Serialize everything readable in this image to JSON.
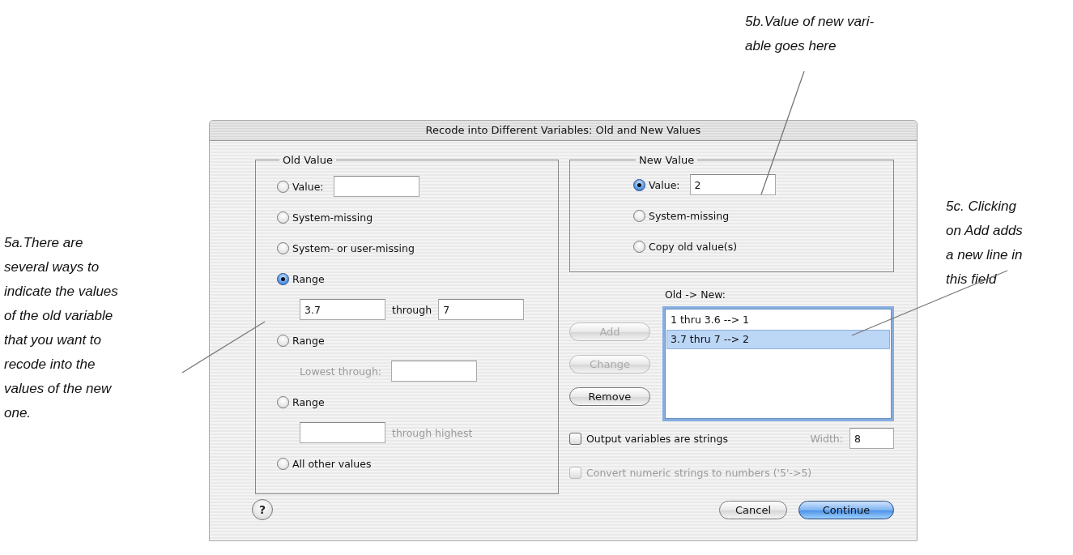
{
  "annotations": [
    {
      "kind": "left",
      "text": "5a.There are\nseveral ways to\nindicate the values\nof the old variable\nthat you want to\nrecode into the\nvalues of the new\none."
    },
    {
      "kind": "top",
      "text": "5b.Value of new vari-\nable goes here"
    },
    {
      "kind": "right",
      "text": "5c. Clicking\non Add adds\na new line in\nthis field"
    }
  ],
  "dialog": {
    "title": "Recode into Different Variables: Old and New Values",
    "old_value": {
      "legend": "Old Value",
      "options": [
        {
          "kind": "field",
          "label": "Value:",
          "selected": false
        },
        {
          "kind": "plain",
          "label": "System-missing",
          "selected": false
        },
        {
          "kind": "plain",
          "label": "System- or user-missing",
          "selected": false
        },
        {
          "kind": "range",
          "label": "Range",
          "selected": true,
          "from": "3.7",
          "joiner": "through",
          "to": "7"
        },
        {
          "kind": "lowest",
          "label": "Range",
          "selected": false,
          "caption": "Lowest through:"
        },
        {
          "kind": "highest",
          "label": "Range",
          "selected": false,
          "caption": "through highest"
        },
        {
          "kind": "plain",
          "label": "All other values",
          "selected": false
        }
      ]
    },
    "new_value": {
      "legend": "New Value",
      "options": [
        {
          "kind": "field",
          "label": "Value:",
          "selected": true,
          "value": "2"
        },
        {
          "kind": "plain",
          "label": "System-missing",
          "selected": false
        },
        {
          "kind": "plain",
          "label": "Copy old value(s)",
          "selected": false
        }
      ]
    },
    "side_buttons": [
      {
        "label": "Add",
        "disabled": true
      },
      {
        "label": "Change",
        "disabled": true
      },
      {
        "label": "Remove",
        "disabled": false
      }
    ],
    "mapping": {
      "label": "Old -> New:",
      "items": [
        {
          "text": "1 thru 3.6 --> 1",
          "selected": false
        },
        {
          "text": "3.7 thru 7 --> 2",
          "selected": true
        }
      ]
    },
    "checkboxes": [
      {
        "label": "Output variables are strings",
        "checked": false,
        "disabled": false
      },
      {
        "label": "Convert numeric strings to numbers ('5'->5)",
        "checked": false,
        "disabled": true
      }
    ],
    "width": {
      "label": "Width:",
      "disabled": true,
      "value": "8"
    },
    "help": "?",
    "footer_buttons": [
      {
        "label": "Cancel",
        "default": false
      },
      {
        "label": "Continue",
        "default": true
      }
    ]
  }
}
